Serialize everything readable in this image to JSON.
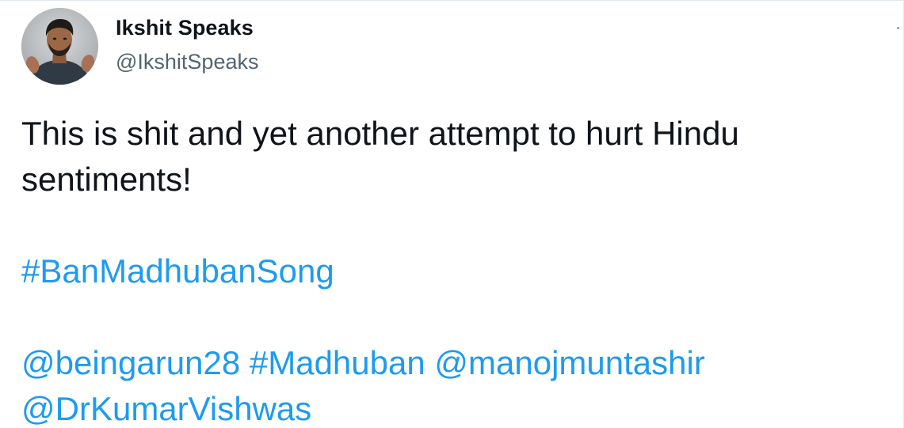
{
  "author": {
    "display_name": "Ikshit Speaks",
    "handle": "@IkshitSpeaks",
    "avatar_icon": "profile-photo"
  },
  "tweet": {
    "line1": "This is shit and yet another attempt to hurt Hindu",
    "line2": "sentiments!",
    "hashtag1": "#BanMadhubanSong",
    "mention1": "@beingarun28",
    "hashtag2": "#Madhuban",
    "mention2": "@manojmuntashir",
    "mention3": "@DrKumarVishwas"
  },
  "colors": {
    "link": "#1d9bf0",
    "text": "#0f1419",
    "handle": "#536471"
  }
}
